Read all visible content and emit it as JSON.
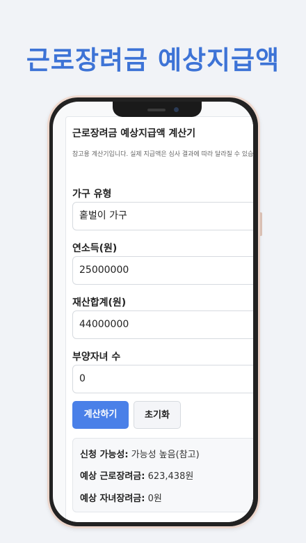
{
  "page": {
    "headline": "근로장려금 예상지급액",
    "accent_color": "#3d73d6"
  },
  "calculator": {
    "title": "근로장려금 예상지급액 계산기",
    "description": "참고용 계산기입니다. 실제 지급액은 심사 결과에 따라 달라질 수 있습니다.",
    "fields": {
      "household_type": {
        "label": "가구 유형",
        "value": "홑벌이 가구"
      },
      "annual_income": {
        "label": "연소득(원)",
        "value": "25000000"
      },
      "total_assets": {
        "label": "재산합계(원)",
        "value": "44000000"
      },
      "dependent_children": {
        "label": "부양자녀 수",
        "value": "0"
      }
    },
    "buttons": {
      "calculate": "계산하기",
      "reset": "초기화"
    },
    "result": {
      "eligibility_label": "신청 가능성:",
      "eligibility_value": "가능성 높음(참고)",
      "earned_credit_label": "예상 근로장려금:",
      "earned_credit_value": "623,438원",
      "child_credit_label": "예상 자녀장려금:",
      "child_credit_value": "0원"
    }
  }
}
